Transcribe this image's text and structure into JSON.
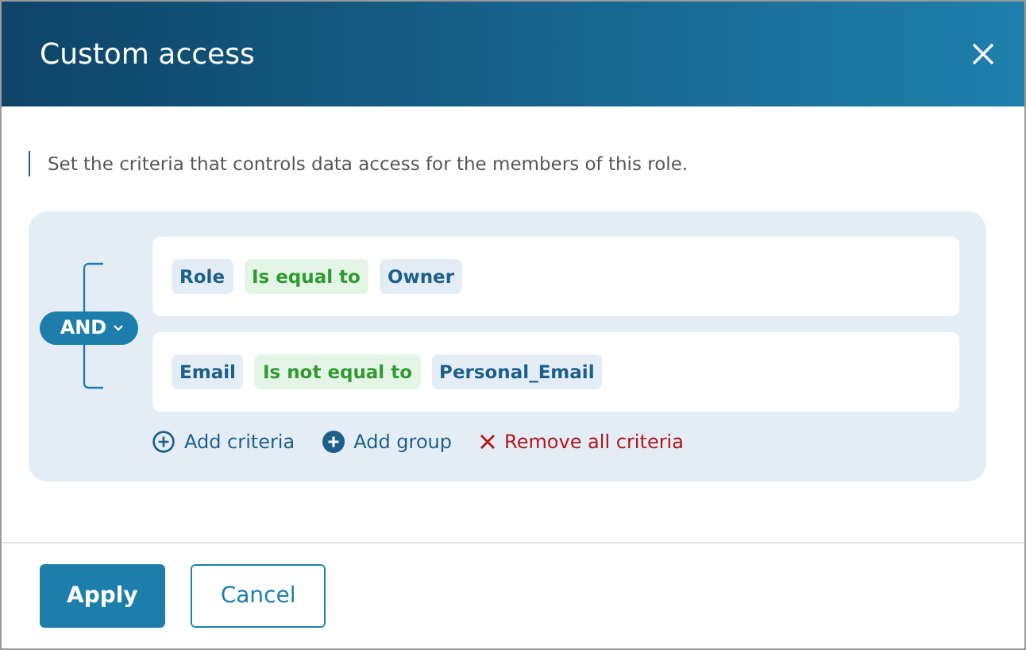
{
  "dialog": {
    "title": "Custom access",
    "description": "Set the criteria that controls data access for the members of this role."
  },
  "group": {
    "operator": "AND",
    "rows": [
      {
        "chips": [
          {
            "kind": "field",
            "text": "Role"
          },
          {
            "kind": "operator",
            "text": "Is equal to"
          },
          {
            "kind": "value",
            "text": "Owner"
          }
        ]
      },
      {
        "chips": [
          {
            "kind": "field",
            "text": "Email"
          },
          {
            "kind": "operator",
            "text": "Is not equal to"
          },
          {
            "kind": "value",
            "text": "Personal_Email"
          }
        ]
      }
    ],
    "actions": [
      {
        "kind": "add-criteria",
        "label": "Add criteria"
      },
      {
        "kind": "add-group",
        "label": "Add group"
      },
      {
        "kind": "remove",
        "label": "Remove all criteria"
      }
    ]
  },
  "buttons": [
    {
      "kind": "primary",
      "label": "Apply"
    },
    {
      "kind": "secondary",
      "label": "Cancel"
    }
  ]
}
